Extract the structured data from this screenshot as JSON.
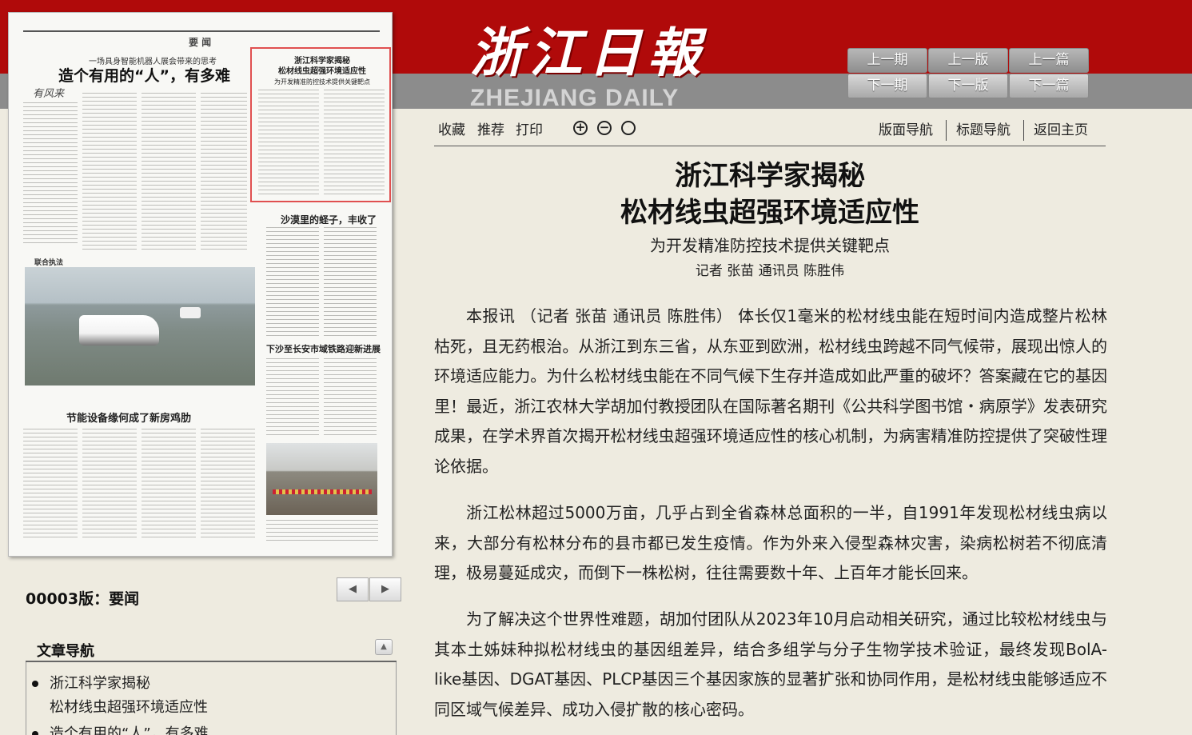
{
  "masthead": {
    "chinese": "浙江日報",
    "english": "ZHEJIANG DAILY"
  },
  "issue_nav": {
    "prev_issue": "上一期",
    "prev_page": "上一版",
    "prev_article": "上一篇",
    "next_issue": "下一期",
    "next_page": "下一版",
    "next_article": "下一篇"
  },
  "newspaper_page": {
    "section": "要 闻",
    "head1_kicker": "一场具身智能机器人展会带来的思考",
    "head1": "造个有用的“人”，有多难",
    "signature": "有风来",
    "boxed_title_1": "浙江科学家揭秘",
    "boxed_title_2": "松材线虫超强环境适应性",
    "boxed_title_3": "为开发精准防控技术提供关键靶点",
    "head2": "沙漠里的蛏子，丰收了",
    "head3": "下沙至长安市域铁路迎新进展",
    "head4": "节能设备缘何成了新房鸡肋",
    "col_label": "联合执法"
  },
  "page_label": "00003版：要闻",
  "arrows": {
    "prev": "◀",
    "next": "▶"
  },
  "article_nav": {
    "title": "文章导航",
    "collapse_icon": "▲",
    "items": [
      {
        "line1": "浙江科学家揭秘",
        "line2": "松材线虫超强环境适应性"
      },
      {
        "line1": "造个有用的“人”，有多难"
      }
    ]
  },
  "toolbar": {
    "collect": "收藏",
    "recommend": "推荐",
    "print": "打印",
    "zoom_in": "+",
    "zoom_out": "−",
    "zoom_reset": "○",
    "page_nav": "版面导航",
    "title_nav": "标题导航",
    "home": "返回主页"
  },
  "article": {
    "title_line1": "浙江科学家揭秘",
    "title_line2": "松材线虫超强环境适应性",
    "subtitle": "为开发精准防控技术提供关键靶点",
    "byline": "记者 张苗 通讯员 陈胜伟",
    "paragraphs": [
      "本报讯 （记者 张苗 通讯员 陈胜伟） 体长仅1毫米的松材线虫能在短时间内造成整片松林枯死，且无药根治。从浙江到东三省，从东亚到欧洲，松材线虫跨越不同气候带，展现出惊人的环境适应能力。为什么松材线虫能在不同气候下生存并造成如此严重的破坏？答案藏在它的基因里！最近，浙江农林大学胡加付教授团队在国际著名期刊《公共科学图书馆・病原学》发表研究成果，在学术界首次揭开松材线虫超强环境适应性的核心机制，为病害精准防控提供了突破性理论依据。",
      "浙江松林超过5000万亩，几乎占到全省森林总面积的一半，自1991年发现松材线虫病以来，大部分有松林分布的县市都已发生疫情。作为外来入侵型森林灾害，染病松树若不彻底清理，极易蔓延成灾，而倒下一株松树，往往需要数十年、上百年才能长回来。",
      "为了解决这个世界性难题，胡加付团队从2023年10月启动相关研究，通过比较松材线虫与其本土姊妹种拟松材线虫的基因组差异，结合多组学与分子生物学技术验证，最终发现BolA-like基因、DGAT基因、PLCP基因三个基因家族的显著扩张和协同作用，是松材线虫能够适应不同区域气候差异、成功入侵扩散的核心密码。"
    ]
  }
}
